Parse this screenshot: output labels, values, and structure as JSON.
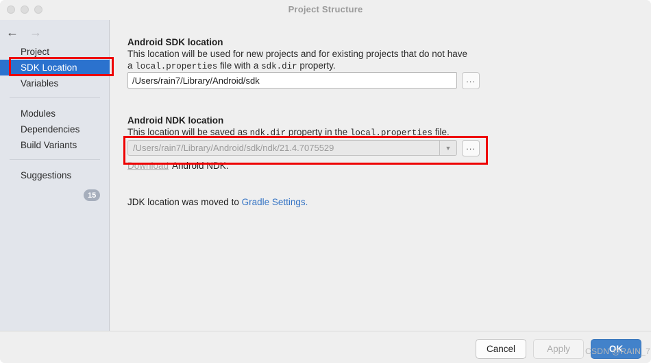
{
  "window": {
    "title": "Project Structure",
    "traffic_lights": [
      "close-button",
      "minimize-button",
      "maximize-button"
    ]
  },
  "nav": {
    "back_icon": "←",
    "forward_icon": "→"
  },
  "sidebar": {
    "items": [
      {
        "label": "Project",
        "selected": false
      },
      {
        "label": "SDK Location",
        "selected": true
      },
      {
        "label": "Variables",
        "selected": false
      },
      {
        "label": "Modules",
        "selected": false
      },
      {
        "label": "Dependencies",
        "selected": false
      },
      {
        "label": "Build Variants",
        "selected": false
      },
      {
        "label": "Suggestions",
        "selected": false
      }
    ],
    "suggestions_badge": "15"
  },
  "main": {
    "sdk": {
      "title": "Android SDK location",
      "desc_line1_a": "This location will be used for new projects and for existing projects that do not have",
      "desc_line2_a": "a ",
      "desc_line2_mono1": "local.properties",
      "desc_line2_b": " file with a ",
      "desc_line2_mono2": "sdk.dir",
      "desc_line2_c": " property.",
      "value": "/Users/rain7/Library/Android/sdk",
      "browse_label": "..."
    },
    "ndk": {
      "title": "Android NDK location",
      "desc_a": "This location will be saved as ",
      "desc_mono1": "ndk.dir",
      "desc_b": " property in the ",
      "desc_mono2": "local.properties",
      "desc_c": " file.",
      "value": "/Users/rain7/Library/Android/sdk/ndk/21.4.7075529",
      "dropdown_icon": "▼",
      "browse_label": "..."
    },
    "download_link": "Download",
    "download_suffix": "Android NDK.",
    "jdk_text": "JDK location was moved to",
    "jdk_link": "Gradle Settings."
  },
  "footer": {
    "cancel": "Cancel",
    "apply": "Apply",
    "ok": "OK"
  },
  "watermark": "CSDN @RAIN_7",
  "colors": {
    "selection_blue": "#2B72CE",
    "primary_button": "#4282CA",
    "link_blue": "#3574C4",
    "annotation_red": "#EE0000",
    "sidebar_bg": "#E2E5EB",
    "content_bg": "#EFEFEF"
  }
}
